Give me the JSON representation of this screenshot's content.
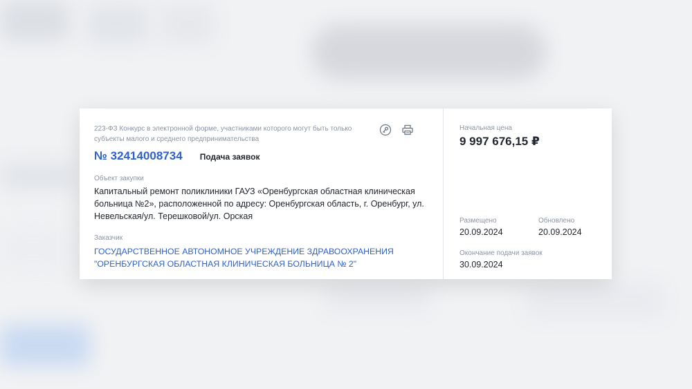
{
  "procurement": {
    "law_text": "223-ФЗ Конкурс в электронной форме, участниками которого могут быть только субъекты малого и среднего предпринимательства",
    "number": "№ 32414008734",
    "status": "Подача заявок",
    "object_label": "Объект закупки",
    "object_text": "Капитальный ремонт поликлиники ГАУЗ «Оренбургская областная клиническая больница №2», расположенной по адресу: Оренбургская область, г. Оренбург, ул. Невельская/ул. Терешковой/ул. Орская",
    "customer_label": "Заказчик",
    "customer_text": "ГОСУДАРСТВЕННОЕ АВТОНОМНОЕ УЧРЕЖДЕНИЕ ЗДРАВООХРАНЕНИЯ \"ОРЕНБУРГСКАЯ ОБЛАСТНАЯ КЛИНИЧЕСКАЯ БОЛЬНИЦА № 2\""
  },
  "icons": {
    "key": "key-icon",
    "print": "print-icon"
  },
  "summary": {
    "price_label": "Начальная цена",
    "price": "9 997 676,15 ₽",
    "placed_label": "Размещено",
    "placed": "20.09.2024",
    "updated_label": "Обновлено",
    "updated": "20.09.2024",
    "deadline_label": "Окончание подачи заявок",
    "deadline": "30.09.2024"
  },
  "colors": {
    "accent": "#2f62c7",
    "muted": "#8b94a3",
    "text": "#22262e"
  }
}
